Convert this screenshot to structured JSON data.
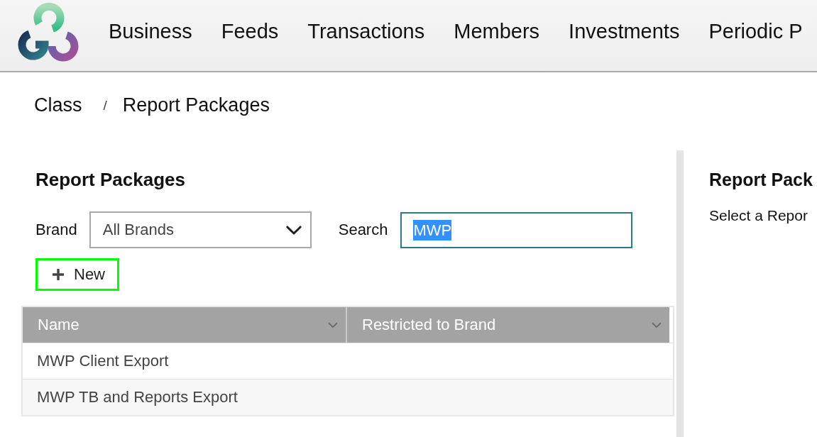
{
  "header": {
    "nav_items": [
      {
        "label": "Business"
      },
      {
        "label": "Feeds"
      },
      {
        "label": "Transactions"
      },
      {
        "label": "Members"
      },
      {
        "label": "Investments"
      },
      {
        "label": "Periodic P"
      }
    ]
  },
  "breadcrumb": {
    "items": [
      {
        "label": "Class"
      },
      {
        "label": "Report Packages"
      }
    ],
    "separator": "/"
  },
  "list_panel": {
    "title": "Report Packages",
    "brand_filter": {
      "label": "Brand",
      "value": "All Brands"
    },
    "search": {
      "label": "Search",
      "value": "MWP",
      "text_selected": true
    },
    "new_button": {
      "label": "New",
      "focused": true
    },
    "table": {
      "columns": [
        {
          "label": "Name"
        },
        {
          "label": "Restricted to Brand"
        }
      ],
      "rows": [
        {
          "name": "MWP Client Export"
        },
        {
          "name": "MWP TB and Reports Export"
        }
      ]
    }
  },
  "detail_panel": {
    "title": "Report Pack",
    "message": "Select a Repor"
  }
}
